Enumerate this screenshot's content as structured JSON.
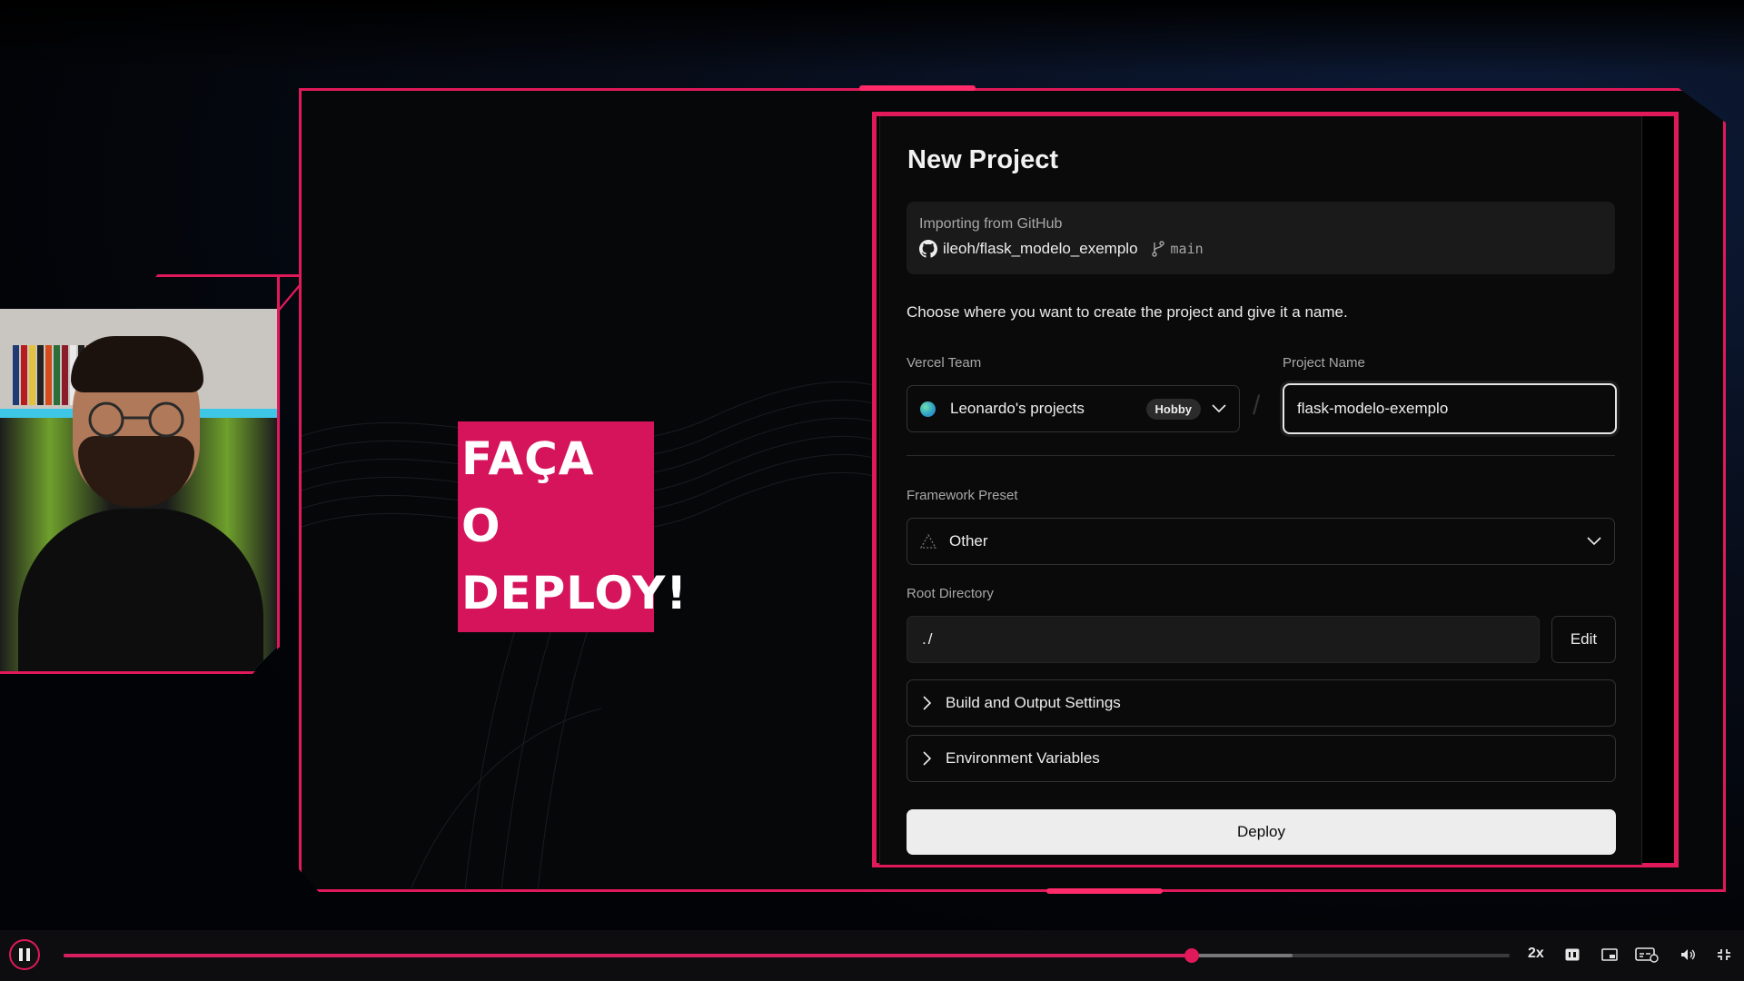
{
  "video": {
    "caption_line1": "FAÇA O",
    "caption_line2": "DEPLOY!",
    "accent_color": "#e0195a"
  },
  "vercel": {
    "title": "New Project",
    "import": {
      "label": "Importing from GitHub",
      "repo": "ileoh/flask_modelo_exemplo",
      "branch": "main"
    },
    "description": "Choose where you want to create the project and give it a name.",
    "team": {
      "label": "Vercel Team",
      "value": "Leonardo's projects",
      "badge": "Hobby"
    },
    "project_name": {
      "label": "Project Name",
      "value": "flask-modelo-exemplo"
    },
    "framework": {
      "label": "Framework Preset",
      "value": "Other"
    },
    "root_directory": {
      "label": "Root Directory",
      "value": "./",
      "edit_label": "Edit"
    },
    "sections": {
      "build": "Build and Output Settings",
      "env": "Environment Variables"
    },
    "deploy_label": "Deploy"
  },
  "player": {
    "speed": "2x",
    "progress_fraction": 0.78,
    "buffered_fraction": 0.85,
    "icons": [
      "pause-icon",
      "hd-icon",
      "miniplayer-icon",
      "subtitles-icon",
      "volume-icon",
      "fullscreen-exit-icon"
    ]
  }
}
